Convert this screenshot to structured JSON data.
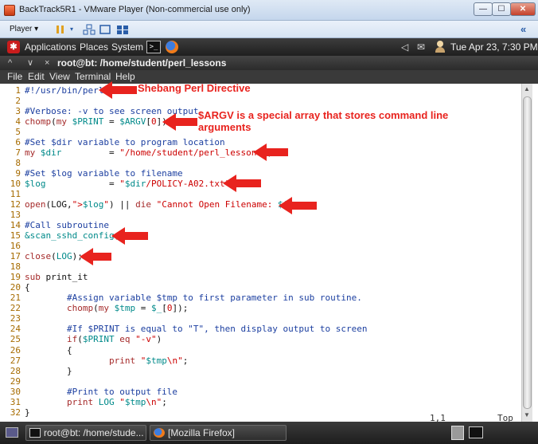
{
  "vm_window": {
    "title": "BackTrack5R1 - VMware Player (Non-commercial use only)",
    "player_menu": "Player ▾",
    "controls": [
      "—",
      "☐",
      "✕"
    ],
    "collapse": "«"
  },
  "gnome_panel": {
    "menus": [
      "Applications",
      "Places",
      "System"
    ],
    "terminal_icon": ">_",
    "tray": [
      "◁",
      "✉"
    ],
    "clock": "Tue Apr 23,  7:30 PM"
  },
  "terminal": {
    "title_buttons": [
      "^",
      "∨",
      "×"
    ],
    "title": "root@bt: /home/student/perl_lessons",
    "menu": [
      "File",
      "Edit",
      "View",
      "Terminal",
      "Help"
    ]
  },
  "code": [
    {
      "n": "1",
      "segs": [
        {
          "c": "com",
          "t": "#!/usr/bin/perl"
        }
      ]
    },
    {
      "n": "2",
      "segs": []
    },
    {
      "n": "3",
      "segs": [
        {
          "c": "com",
          "t": "#Verbose: -v to see screen output"
        }
      ]
    },
    {
      "n": "4",
      "segs": [
        {
          "c": "fn",
          "t": "chomp"
        },
        {
          "c": "plain",
          "t": "("
        },
        {
          "c": "fn",
          "t": "my "
        },
        {
          "c": "var",
          "t": "$PRINT"
        },
        {
          "c": "plain",
          "t": " = "
        },
        {
          "c": "var",
          "t": "$ARGV"
        },
        {
          "c": "plain",
          "t": "["
        },
        {
          "c": "str",
          "t": "0"
        },
        {
          "c": "plain",
          "t": "]);"
        }
      ]
    },
    {
      "n": "5",
      "segs": []
    },
    {
      "n": "6",
      "segs": [
        {
          "c": "com",
          "t": "#Set $dir variable to program location"
        }
      ]
    },
    {
      "n": "7",
      "segs": [
        {
          "c": "fn",
          "t": "my "
        },
        {
          "c": "var",
          "t": "$dir"
        },
        {
          "c": "plain",
          "t": "         = "
        },
        {
          "c": "str",
          "t": "\"/home/student/perl_lessons\""
        },
        {
          "c": "plain",
          "t": ";"
        }
      ]
    },
    {
      "n": "8",
      "segs": []
    },
    {
      "n": "9",
      "segs": [
        {
          "c": "com",
          "t": "#Set $log variable to filename"
        }
      ]
    },
    {
      "n": "10",
      "segs": [
        {
          "c": "var",
          "t": "$log"
        },
        {
          "c": "plain",
          "t": "            = "
        },
        {
          "c": "str",
          "t": "\""
        },
        {
          "c": "var",
          "t": "$dir"
        },
        {
          "c": "str",
          "t": "/POLICY-A02.txt\""
        },
        {
          "c": "plain",
          "t": ";"
        }
      ]
    },
    {
      "n": "11",
      "segs": []
    },
    {
      "n": "12",
      "segs": [
        {
          "c": "fn",
          "t": "open"
        },
        {
          "c": "plain",
          "t": "(LOG,"
        },
        {
          "c": "str",
          "t": "\">"
        },
        {
          "c": "var",
          "t": "$log"
        },
        {
          "c": "str",
          "t": "\""
        },
        {
          "c": "plain",
          "t": ") || "
        },
        {
          "c": "fn",
          "t": "die"
        },
        {
          "c": "plain",
          "t": " "
        },
        {
          "c": "str",
          "t": "\"Cannot Open Filename: "
        },
        {
          "c": "var",
          "t": "$!"
        },
        {
          "c": "str",
          "t": "\""
        },
        {
          "c": "plain",
          "t": ";"
        }
      ]
    },
    {
      "n": "13",
      "segs": []
    },
    {
      "n": "14",
      "segs": [
        {
          "c": "com",
          "t": "#Call subroutine"
        }
      ]
    },
    {
      "n": "15",
      "segs": [
        {
          "c": "var",
          "t": "&scan_sshd_config"
        },
        {
          "c": "plain",
          "t": ";"
        }
      ]
    },
    {
      "n": "16",
      "segs": []
    },
    {
      "n": "17",
      "segs": [
        {
          "c": "fn",
          "t": "close"
        },
        {
          "c": "plain",
          "t": "("
        },
        {
          "c": "var",
          "t": "LOG"
        },
        {
          "c": "plain",
          "t": ");"
        }
      ]
    },
    {
      "n": "18",
      "segs": []
    },
    {
      "n": "19",
      "segs": [
        {
          "c": "fn",
          "t": "sub "
        },
        {
          "c": "plain",
          "t": "print_it"
        }
      ]
    },
    {
      "n": "20",
      "segs": [
        {
          "c": "plain",
          "t": "{"
        }
      ]
    },
    {
      "n": "21",
      "segs": [
        {
          "c": "com",
          "t": "        #Assign variable $tmp to first parameter in sub routine."
        }
      ]
    },
    {
      "n": "22",
      "segs": [
        {
          "c": "plain",
          "t": "        "
        },
        {
          "c": "fn",
          "t": "chomp"
        },
        {
          "c": "plain",
          "t": "("
        },
        {
          "c": "fn",
          "t": "my "
        },
        {
          "c": "var",
          "t": "$tmp"
        },
        {
          "c": "plain",
          "t": " = "
        },
        {
          "c": "var",
          "t": "$_"
        },
        {
          "c": "plain",
          "t": "["
        },
        {
          "c": "str",
          "t": "0"
        },
        {
          "c": "plain",
          "t": "]);"
        }
      ]
    },
    {
      "n": "23",
      "segs": []
    },
    {
      "n": "24",
      "segs": [
        {
          "c": "com",
          "t": "        #If $PRINT is equal to \"T\", then display output to screen"
        }
      ]
    },
    {
      "n": "25",
      "segs": [
        {
          "c": "plain",
          "t": "        "
        },
        {
          "c": "fn",
          "t": "if"
        },
        {
          "c": "plain",
          "t": "("
        },
        {
          "c": "var",
          "t": "$PRINT"
        },
        {
          "c": "plain",
          "t": " "
        },
        {
          "c": "fn",
          "t": "eq"
        },
        {
          "c": "plain",
          "t": " "
        },
        {
          "c": "str",
          "t": "\"-v\""
        },
        {
          "c": "plain",
          "t": ")"
        }
      ]
    },
    {
      "n": "26",
      "segs": [
        {
          "c": "plain",
          "t": "        {"
        }
      ]
    },
    {
      "n": "27",
      "segs": [
        {
          "c": "plain",
          "t": "                "
        },
        {
          "c": "fn",
          "t": "print"
        },
        {
          "c": "plain",
          "t": " "
        },
        {
          "c": "str",
          "t": "\""
        },
        {
          "c": "var",
          "t": "$tmp"
        },
        {
          "c": "str",
          "t": "\\n\""
        },
        {
          "c": "plain",
          "t": ";"
        }
      ]
    },
    {
      "n": "28",
      "segs": [
        {
          "c": "plain",
          "t": "        }"
        }
      ]
    },
    {
      "n": "29",
      "segs": []
    },
    {
      "n": "30",
      "segs": [
        {
          "c": "com",
          "t": "        #Print to output file"
        }
      ]
    },
    {
      "n": "31",
      "segs": [
        {
          "c": "plain",
          "t": "        "
        },
        {
          "c": "fn",
          "t": "print"
        },
        {
          "c": "plain",
          "t": " "
        },
        {
          "c": "var",
          "t": "LOG"
        },
        {
          "c": "plain",
          "t": " "
        },
        {
          "c": "str",
          "t": "\""
        },
        {
          "c": "var",
          "t": "$tmp"
        },
        {
          "c": "str",
          "t": "\\n\""
        },
        {
          "c": "plain",
          "t": ";"
        }
      ]
    },
    {
      "n": "32",
      "segs": [
        {
          "c": "plain",
          "t": "}"
        }
      ]
    }
  ],
  "editor_status": {
    "position": "1,1",
    "scroll": "Top"
  },
  "annotations": {
    "shebang": "Shebang Perl Directive",
    "argv_line1": "$ARGV  is a special array that stores command line",
    "argv_line2": "arguments",
    "color": "#e8231e"
  },
  "taskbar": {
    "tasks": [
      "root@bt: /home/stude...",
      "[Mozilla Firefox]"
    ]
  }
}
